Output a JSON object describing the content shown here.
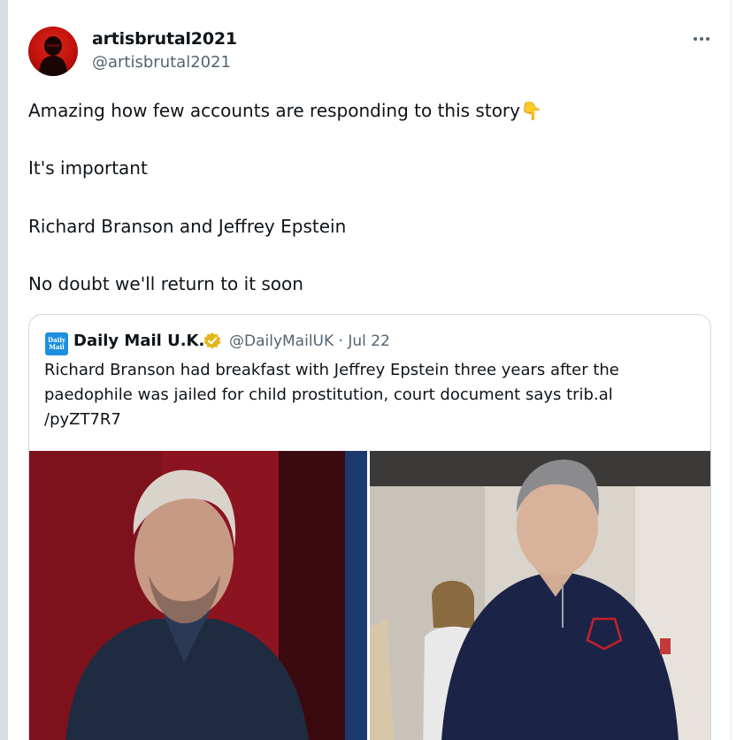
{
  "tweet": {
    "display_name": "artisbrutal2021",
    "handle": "@artisbrutal2021",
    "more_icon": "more-horizontal-icon",
    "lines": [
      "Amazing how few accounts are responding to this story👇",
      "It's important",
      "Richard Branson and Jeffrey Epstein",
      "No doubt we'll return to it soon"
    ]
  },
  "quote": {
    "logo_text": "Daily Mail",
    "source_name": "Daily Mail U.K.",
    "verified_icon": "verified-gold-badge-icon",
    "meta": "@DailyMailUK · Jul 22",
    "text_lines": [
      "Richard Branson had breakfast with Jeffrey Epstein three years after the",
      "paedophile was jailed for child prostitution, court document says trib.al",
      "/pyZT7R7"
    ]
  },
  "colors": {
    "text": "#0f1419",
    "secondary": "#536471",
    "border": "#cfd9de",
    "verified_gold": "#e2b719",
    "daily_mail_blue": "#1d8fe0"
  }
}
